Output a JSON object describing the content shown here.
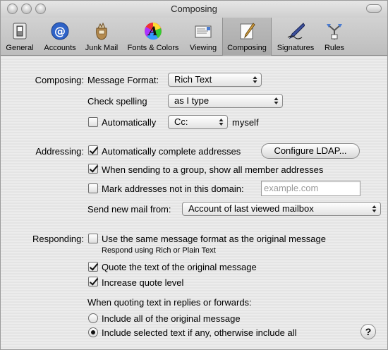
{
  "window": {
    "title": "Composing"
  },
  "toolbar": {
    "items": [
      {
        "label": "General",
        "icon": "general-switch-icon"
      },
      {
        "label": "Accounts",
        "icon": "at-sign-icon"
      },
      {
        "label": "Junk Mail",
        "icon": "junk-bag-icon"
      },
      {
        "label": "Fonts & Colors",
        "icon": "color-wheel-icon"
      },
      {
        "label": "Viewing",
        "icon": "envelope-view-icon"
      },
      {
        "label": "Composing",
        "icon": "pen-paper-icon",
        "selected": true
      },
      {
        "label": "Signatures",
        "icon": "fountain-pen-icon"
      },
      {
        "label": "Rules",
        "icon": "rules-icon"
      }
    ]
  },
  "composing": {
    "section_label": "Composing:",
    "message_format_label": "Message Format:",
    "message_format_value": "Rich Text",
    "check_spelling_label": "Check spelling",
    "check_spelling_value": "as I type",
    "automatically_label": "Automatically",
    "automatically_checked": false,
    "cc_value": "Cc:",
    "myself_label": "myself"
  },
  "addressing": {
    "section_label": "Addressing:",
    "auto_complete_label": "Automatically complete addresses",
    "auto_complete_checked": true,
    "configure_ldap_label": "Configure LDAP...",
    "show_members_label": "When sending to a group, show all member addresses",
    "show_members_checked": true,
    "mark_addresses_label": "Mark addresses not in this domain:",
    "mark_addresses_checked": false,
    "domain_placeholder": "example.com",
    "send_from_label": "Send new mail from:",
    "send_from_value": "Account of last viewed mailbox"
  },
  "responding": {
    "section_label": "Responding:",
    "same_format_label": "Use the same message format as the original message",
    "same_format_checked": false,
    "same_format_note": "Respond using Rich or Plain Text",
    "quote_text_label": "Quote the text of the original message",
    "quote_text_checked": true,
    "increase_quote_label": "Increase quote level",
    "increase_quote_checked": true,
    "when_quoting_label": "When quoting text in replies or forwards:",
    "include_all_label": "Include all of the original message",
    "include_selected_label": "Include selected text if any, otherwise include all",
    "selected_option": "include_selected"
  },
  "help": {
    "label": "?"
  }
}
